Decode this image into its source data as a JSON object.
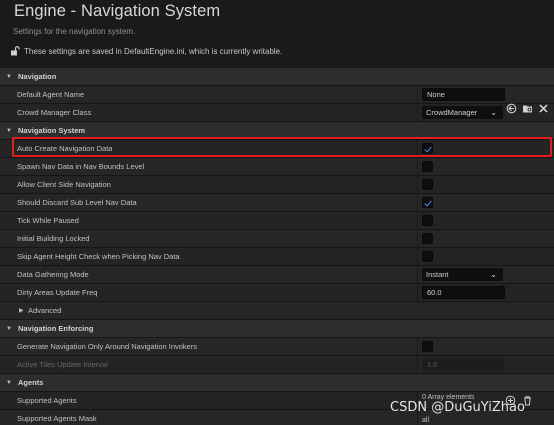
{
  "header": {
    "title": "Engine - Navigation System",
    "subtitle": "Settings for the navigation system.",
    "notice": "These settings are saved in DefaultEngine.ini, which is currently writable."
  },
  "categories": {
    "navigation": "Navigation",
    "navigation_system": "Navigation System",
    "navigation_enforcing": "Navigation Enforcing",
    "agents": "Agents"
  },
  "properties": {
    "default_agent_name": {
      "label": "Default Agent Name",
      "value": "None"
    },
    "crowd_manager_class": {
      "label": "Crowd Manager Class",
      "value": "CrowdManager"
    },
    "auto_create_nav_data": {
      "label": "Auto Create Navigation Data",
      "checked": true
    },
    "spawn_nav_data": {
      "label": "Spawn Nav Data in Nav Bounds Level",
      "checked": false
    },
    "allow_client_side": {
      "label": "Allow Client Side Navigation",
      "checked": false
    },
    "discard_sub_level": {
      "label": "Should Discard Sub Level Nav Data",
      "checked": true
    },
    "tick_while_paused": {
      "label": "Tick While Paused",
      "checked": false
    },
    "initial_building_locked": {
      "label": "Initial Building Locked",
      "checked": false
    },
    "skip_agent_height": {
      "label": "Skip Agent Height Check when Picking Nav Data",
      "checked": false
    },
    "data_gathering_mode": {
      "label": "Data Gathering Mode",
      "value": "Instant"
    },
    "dirty_areas_freq": {
      "label": "Dirty Areas Update Freq",
      "value": "60.0"
    },
    "advanced": {
      "label": "Advanced"
    },
    "generate_around_invokers": {
      "label": "Generate Navigation Only Around Navigation Invokers",
      "checked": false
    },
    "active_tiles_interval": {
      "label": "Active Tiles Update Interval",
      "value": "1.0"
    },
    "supported_agents": {
      "label": "Supported Agents",
      "value": "0 Array elements"
    },
    "supported_agents_mask": {
      "label": "Supported Agents Mask",
      "value": "all"
    }
  },
  "watermark": "CSDN @DuGuYiZhao",
  "colors": {
    "accent": "#3f8be4",
    "highlight": "#e02020"
  }
}
